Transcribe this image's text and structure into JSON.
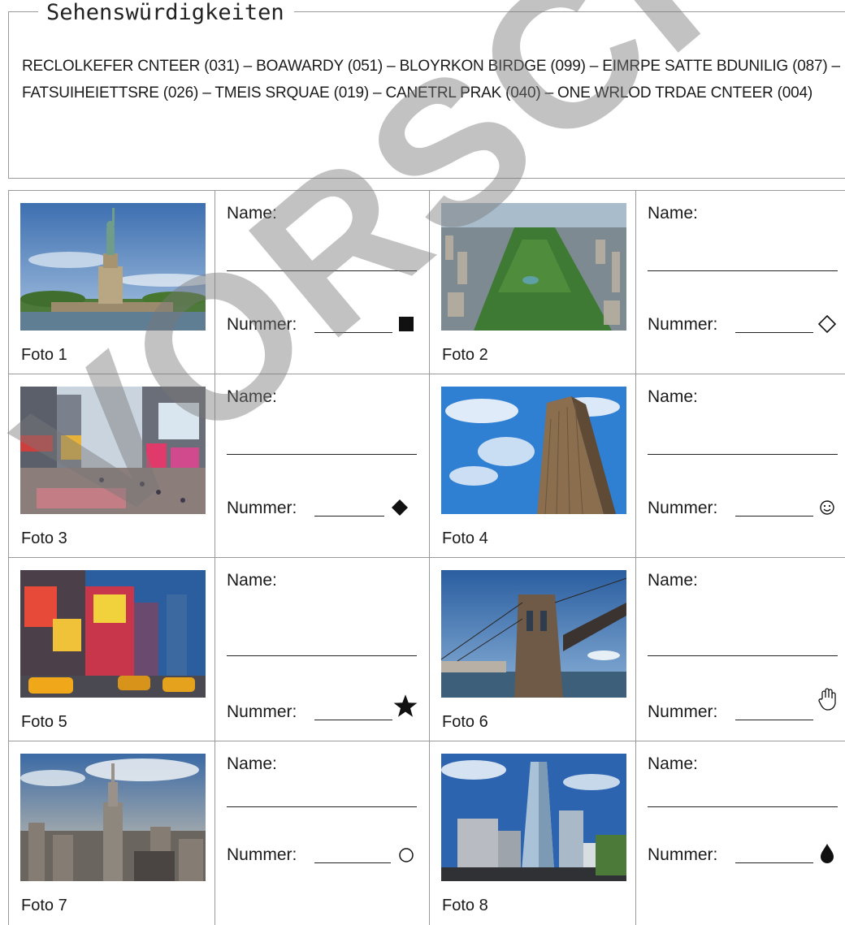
{
  "section": {
    "title": "Sehenswürdigkeiten",
    "scrambled_words": "RECLOLKEFER CNTEER (031) – BOAWARDY (051) – BLOYRKON BIRDGE (099) – EIMRPE SATTE BDUNILIG (087) – FATSUIHEIETTSRE (026) – TMEIS SRQUAE (019) – CANETRL PRAK (040) – ONE WRLOD TRDAE CNTEER (004)"
  },
  "labels": {
    "name": "Name:",
    "nummer": "Nummer:"
  },
  "photos": [
    {
      "label": "Foto 1",
      "symbol": "■",
      "symbol_name": "filled-square-icon"
    },
    {
      "label": "Foto 2",
      "symbol": "◇",
      "symbol_name": "outline-diamond-icon"
    },
    {
      "label": "Foto 3",
      "symbol": "◆",
      "symbol_name": "filled-diamond-icon"
    },
    {
      "label": "Foto 4",
      "symbol": "☺",
      "symbol_name": "smiley-icon"
    },
    {
      "label": "Foto 5",
      "symbol": "★",
      "symbol_name": "filled-star-icon"
    },
    {
      "label": "Foto 6",
      "symbol": "✋",
      "symbol_name": "hand-icon"
    },
    {
      "label": "Foto 7",
      "symbol": "○",
      "symbol_name": "outline-circle-icon"
    },
    {
      "label": "Foto 8",
      "symbol": "●",
      "symbol_name": "drop-icon"
    }
  ],
  "watermark": "VORSCHAU"
}
